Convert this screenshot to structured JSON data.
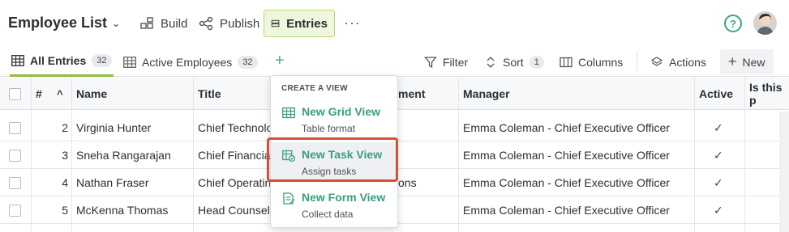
{
  "app": {
    "title": "Employee List"
  },
  "toolbar": {
    "build": "Build",
    "publish": "Publish",
    "entries": "Entries",
    "more": "···",
    "help": "?"
  },
  "views": {
    "all_entries": {
      "label": "All Entries",
      "count": "32"
    },
    "active_employees": {
      "label": "Active Employees",
      "count": "32"
    },
    "add": "+"
  },
  "actions": {
    "filter": "Filter",
    "sort": "Sort",
    "sort_count": "1",
    "columns": "Columns",
    "actions": "Actions",
    "new": "New"
  },
  "columns": {
    "num": "#",
    "sort": "^",
    "name": "Name",
    "title": "Title",
    "department": "ment",
    "manager": "Manager",
    "active": "Active",
    "is_this": "Is this p"
  },
  "rows": [
    {
      "num": "2",
      "name": "Virginia Hunter",
      "title": "Chief Technolo",
      "dept": "",
      "manager": "Emma Coleman - Chief Executive Officer",
      "active": "✓"
    },
    {
      "num": "3",
      "name": "Sneha Rangarajan",
      "title": "Chief Financia",
      "dept": "",
      "manager": "Emma Coleman - Chief Executive Officer",
      "active": "✓"
    },
    {
      "num": "4",
      "name": "Nathan Fraser",
      "title": "Chief Operatin",
      "dept": "ons",
      "manager": "Emma Coleman - Chief Executive Officer",
      "active": "✓"
    },
    {
      "num": "5",
      "name": "McKenna Thomas",
      "title": "Head Counsel",
      "dept": "",
      "manager": "Emma Coleman - Chief Executive Officer",
      "active": "✓"
    }
  ],
  "menu": {
    "heading": "CREATE A VIEW",
    "items": [
      {
        "title": "New Grid View",
        "sub": "Table format"
      },
      {
        "title": "New Task View",
        "sub": "Assign tasks"
      },
      {
        "title": "New Form View",
        "sub": "Collect data"
      }
    ]
  },
  "colors": {
    "accent": "#3a9c84",
    "active_tab": "#8ebf3c",
    "highlight": "#d8512f"
  }
}
